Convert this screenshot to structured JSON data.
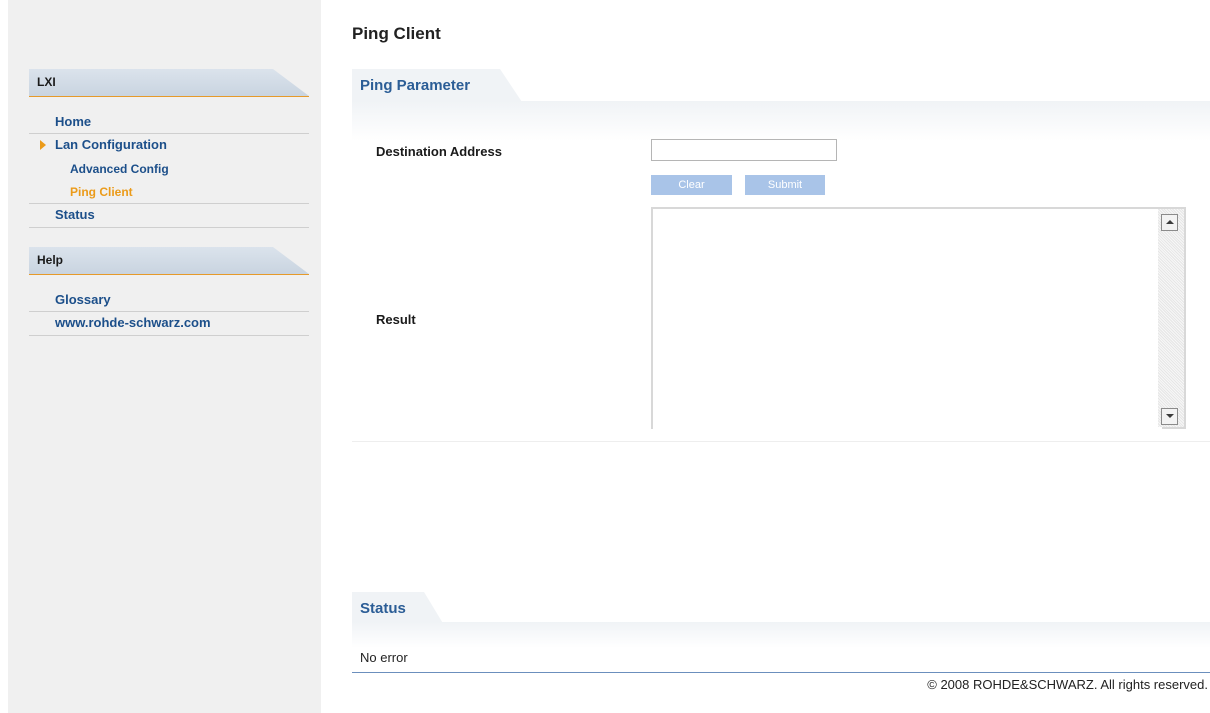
{
  "sidebar": {
    "sections": [
      {
        "title": "LXI"
      },
      {
        "title": "Help"
      }
    ],
    "lxi_items": [
      {
        "label": "Home"
      },
      {
        "label": "Lan Configuration"
      },
      {
        "label": "Advanced Config"
      },
      {
        "label": "Ping Client"
      },
      {
        "label": "Status"
      }
    ],
    "help_items": [
      {
        "label": "Glossary"
      },
      {
        "label": "www.rohde-schwarz.com"
      }
    ]
  },
  "main": {
    "title": "Ping Client",
    "ping_tab": "Ping Parameter",
    "destination_label": "Destination Address",
    "destination_value": "",
    "clear_label": "Clear",
    "submit_label": "Submit",
    "result_label": "Result",
    "result_value": "",
    "status_tab": "Status",
    "status_text": "No error",
    "copyright": "© 2008 ROHDE&SCHWARZ. All rights reserved."
  },
  "colors": {
    "link": "#1c4f8a",
    "active": "#eb9b1a",
    "tab_text": "#2b5d96",
    "button": "#a9c4e8",
    "accent_line": "#e69a2a"
  },
  "icons": {
    "active_indicator": "triangle-right-icon",
    "scroll_up": "chevron-up-icon",
    "scroll_down": "chevron-down-icon"
  }
}
